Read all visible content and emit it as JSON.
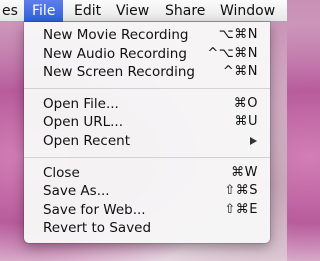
{
  "menubar": {
    "items": [
      {
        "label": "es",
        "active": false
      },
      {
        "label": "File",
        "active": true
      },
      {
        "label": "Edit",
        "active": false
      },
      {
        "label": "View",
        "active": false
      },
      {
        "label": "Share",
        "active": false
      },
      {
        "label": "Window",
        "active": false
      }
    ]
  },
  "file_menu": {
    "groups": [
      [
        {
          "label": "New Movie Recording",
          "shortcut": "⌥⌘N"
        },
        {
          "label": "New Audio Recording",
          "shortcut": "^⌥⌘N"
        },
        {
          "label": "New Screen Recording",
          "shortcut": "^⌘N"
        }
      ],
      [
        {
          "label": "Open File...",
          "shortcut": "⌘O"
        },
        {
          "label": "Open URL...",
          "shortcut": "⌘U"
        },
        {
          "label": "Open Recent",
          "shortcut": "",
          "submenu": true
        }
      ],
      [
        {
          "label": "Close",
          "shortcut": "⌘W"
        },
        {
          "label": "Save As...",
          "shortcut": "⇧⌘S"
        },
        {
          "label": "Save for Web...",
          "shortcut": "⇧⌘E"
        },
        {
          "label": "Revert to Saved",
          "shortcut": ""
        }
      ]
    ]
  },
  "colors": {
    "highlight": "#2f5fe0",
    "menu_background": "#f7f7f7",
    "wallpaper": "#c890b5"
  }
}
